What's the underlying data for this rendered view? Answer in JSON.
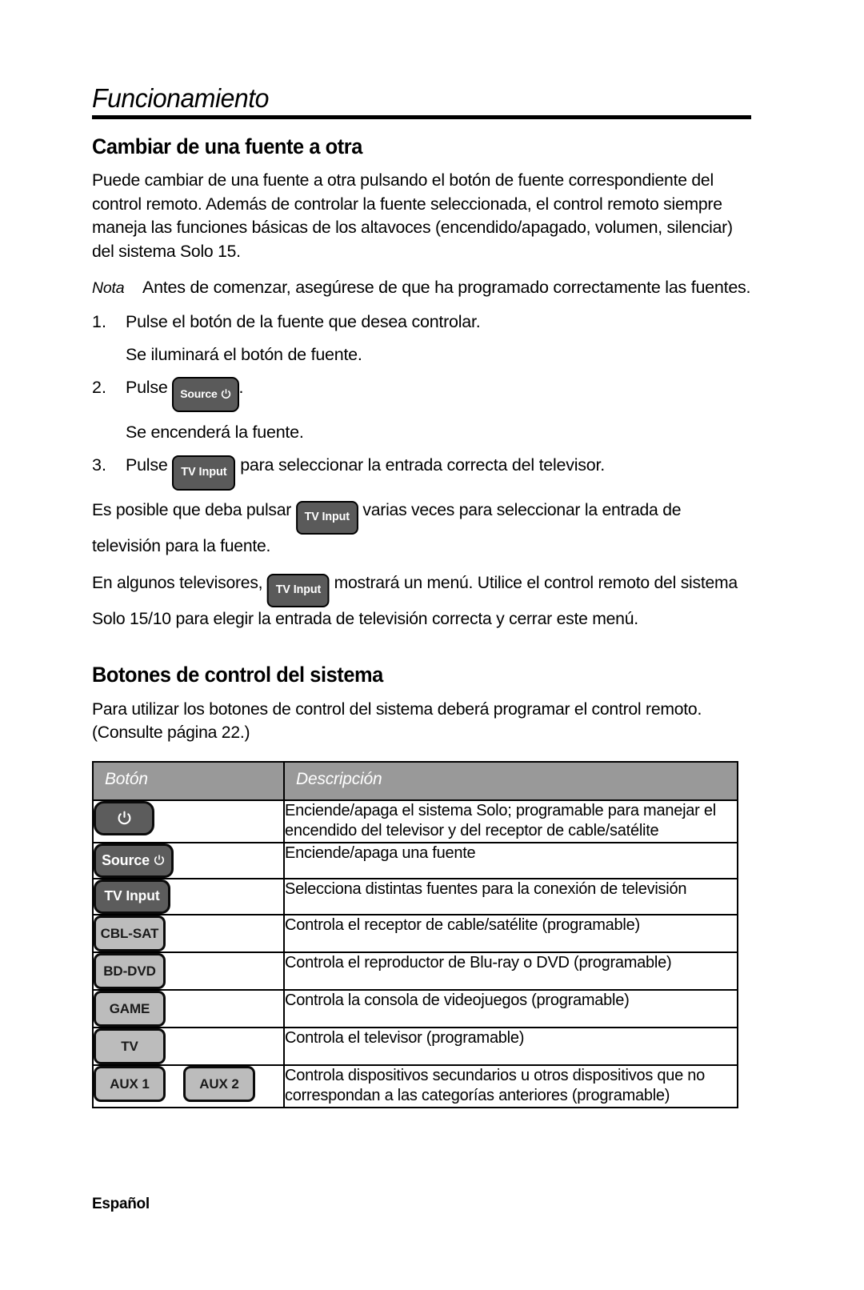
{
  "page": {
    "running_head": "Funcionamiento",
    "footer": "Español"
  },
  "section1": {
    "heading": "Cambiar de una fuente a otra",
    "intro": "Puede cambiar de una fuente a otra pulsando el botón de fuente correspondiente del control remoto. Además de controlar la fuente seleccionada, el control remoto siempre maneja las funciones básicas de los altavoces (encendido/apagado, volumen, silenciar) del sistema Solo 15.",
    "note_label": "Nota",
    "note_text": "Antes de comenzar, asegúrese de que ha programado correctamente las fuentes.",
    "step1_num": "1.",
    "step1_text": "Pulse el botón de la fuente que desea controlar.",
    "step1_result": "Se iluminará el botón de fuente.",
    "step2_num": "2.",
    "step2_prefix": "Pulse",
    "step2_suffix": ".",
    "step2_result": "Se encenderá la fuente.",
    "step3_num": "3.",
    "step3_prefix": "Pulse",
    "step3_suffix": "para seleccionar la entrada correcta del televisor.",
    "para_a_prefix": "Es posible que deba pulsar",
    "para_a_suffix": "varias veces para seleccionar la entrada de televisión para la fuente.",
    "para_b_prefix": "En algunos televisores,",
    "para_b_suffix": "mostrará un menú. Utilice el control remoto del sistema Solo 15/10 para elegir la entrada de televisión correcta y cerrar este menú."
  },
  "chips": {
    "source": "Source",
    "tv_input": "TV Input",
    "power_icon": "power-icon"
  },
  "section2": {
    "heading": "Botones de control del sistema",
    "intro": "Para utilizar los botones de control del sistema deberá programar el control remoto. (Consulte página 22.)"
  },
  "table": {
    "headers": {
      "button": "Botón",
      "description": "Descripción"
    },
    "rows": [
      {
        "keys": [
          {
            "label": "",
            "icon": "power-icon",
            "style": "dark",
            "shape": "power"
          }
        ],
        "description": "Enciende/apaga el sistema Solo; programable para manejar el encendido del televisor y del receptor de cable/satélite"
      },
      {
        "keys": [
          {
            "label": "Source",
            "icon": "power-icon",
            "style": "dark",
            "shape": "source"
          }
        ],
        "description": "Enciende/apaga una fuente"
      },
      {
        "keys": [
          {
            "label": "TV Input",
            "icon": "",
            "style": "dark",
            "shape": "tvinput"
          }
        ],
        "description": "Selecciona distintas fuentes para la conexión de televisión"
      },
      {
        "keys": [
          {
            "label": "CBL-SAT",
            "icon": "",
            "style": "light",
            "shape": "sq"
          }
        ],
        "description": "Controla el receptor de cable/satélite (programable)"
      },
      {
        "keys": [
          {
            "label": "BD-DVD",
            "icon": "",
            "style": "light",
            "shape": "sq"
          }
        ],
        "description": "Controla el reproductor de Blu-ray o DVD (programable)"
      },
      {
        "keys": [
          {
            "label": "GAME",
            "icon": "",
            "style": "light",
            "shape": "sq"
          }
        ],
        "description": "Controla la consola de videojuegos (programable)"
      },
      {
        "keys": [
          {
            "label": "TV",
            "icon": "",
            "style": "light",
            "shape": "sq"
          }
        ],
        "description": "Controla el televisor (programable)"
      },
      {
        "keys": [
          {
            "label": "AUX 1",
            "icon": "",
            "style": "light",
            "shape": "sq"
          },
          {
            "label": "AUX 2",
            "icon": "",
            "style": "light",
            "shape": "sq"
          }
        ],
        "description": "Controla dispositivos secundarios u otros dispositivos que no correspondan a las categorías anteriores (programable)"
      }
    ]
  },
  "colors": {
    "key_dark": "#5c5c5c",
    "key_light": "#bcbcbc",
    "table_header": "#999999",
    "rule": "#000000"
  }
}
